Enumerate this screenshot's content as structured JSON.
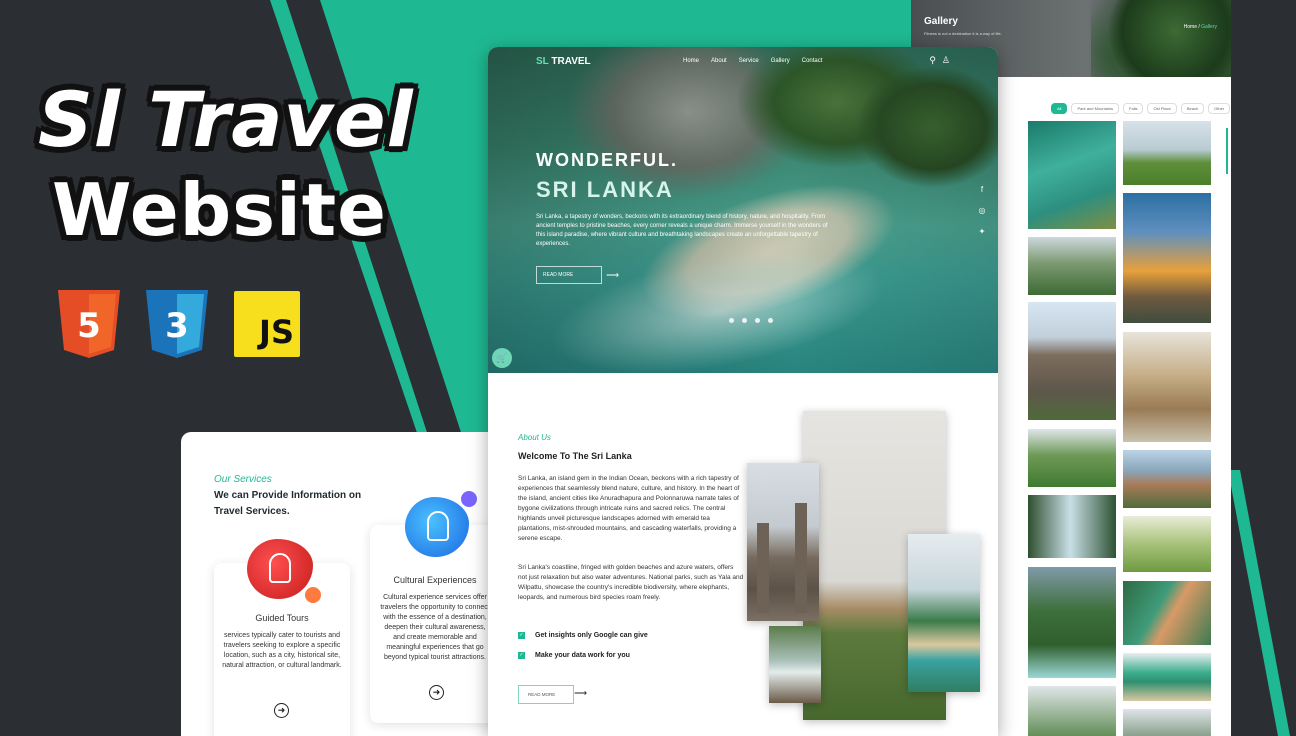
{
  "promo": {
    "title_line1": "Sl Travel",
    "title_line2": "Website",
    "badges": [
      {
        "label": "5",
        "icon": "html5-icon",
        "color": "#e44d26"
      },
      {
        "label": "3",
        "icon": "css3-icon",
        "color": "#1b73ba"
      },
      {
        "label": "JS",
        "icon": "javascript-icon",
        "color": "#f7df1e"
      }
    ]
  },
  "nav": {
    "logo_prefix": "SL",
    "logo_suffix": " TRAVEL",
    "links": [
      "Home",
      "About",
      "Service",
      "Gallery",
      "Contact"
    ],
    "icons": [
      "search-icon",
      "user-icon"
    ]
  },
  "hero": {
    "kicker": "WONDERFUL.",
    "title": "SRI LANKA",
    "paragraph": "Sri Lanka, a tapestry of wonders, beckons with its extraordinary blend of history, nature, and hospitality. From ancient temples to pristine beaches, every corner reveals a unique charm. Immerse yourself in the wonders of this island paradise, where vibrant culture and breathtaking landscapes create an unforgettable tapestry of experiences.",
    "button": "READ MORE",
    "social": [
      "facebook-icon",
      "instagram-icon",
      "twitter-icon"
    ],
    "slides": 4
  },
  "about": {
    "kicker": "About Us",
    "title": "Welcome To The Sri Lanka",
    "paragraph1": "Sri Lanka, an island gem in the Indian Ocean, beckons with a rich tapestry of experiences that seamlessly blend nature, culture, and history. In the heart of the island, ancient cities like Anuradhapura and Polonnaruwa narrate tales of bygone civilizations through intricate ruins and sacred relics. The central highlands unveil picturesque landscapes adorned with emerald tea plantations, mist-shrouded mountains, and cascading waterfalls, providing a serene escape.",
    "paragraph2": "Sri Lanka's coastline, fringed with golden beaches and azure waters, offers not just relaxation but also water adventures. National parks, such as Yala and Wilpattu, showcase the country's incredible biodiversity, where elephants, leopards, and numerous bird species roam freely.",
    "checks": [
      "Get insights only Google can give",
      "Make your data work for you"
    ],
    "button": "READ MORE"
  },
  "services": {
    "kicker": "Our Services",
    "heading": "We can Provide Information on Travel Services.",
    "cards": [
      {
        "title": "Guided Tours",
        "text": "services typically cater to tourists and travelers seeking to explore a specific location, such as a city, historical site, natural attraction, or cultural landmark."
      },
      {
        "title": "Cultural Experiences",
        "text": "Cultural experience services offer travelers the opportunity to connect with the essence of a destination, deepen their cultural awareness, and create memorable and meaningful experiences that go beyond typical tourist attractions."
      }
    ]
  },
  "gallery": {
    "title": "Gallery",
    "subtitle": "Fitness is not a destination it is a way of life.",
    "crumb_home": "Home",
    "crumb_sep": " / ",
    "crumb_current": "Gallery",
    "filters": [
      "All",
      "Park and Mountains",
      "Falls",
      "Old Place",
      "Beach",
      "Other"
    ]
  },
  "colors": {
    "accent": "#1eb992",
    "background": "#2b2f33"
  }
}
